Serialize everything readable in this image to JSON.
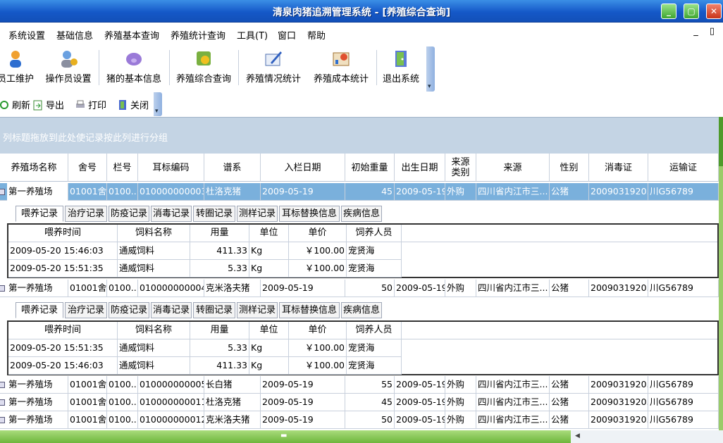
{
  "window": {
    "title": "清泉肉猪追溯管理系统 - [养殖综合查询]"
  },
  "menu": [
    "系统设置",
    "基础信息",
    "养殖基本查询",
    "养殖统计查询",
    "工具(T)",
    "窗口",
    "帮助"
  ],
  "mdi_controls": "_ ▯",
  "toolbar": [
    "员工维护",
    "操作员设置",
    "猪的基本信息",
    "养殖综合查询",
    "养殖情况统计",
    "养殖成本统计",
    "退出系统"
  ],
  "toolbar2": [
    "刷新",
    "导出",
    "打印",
    "关闭"
  ],
  "group_hint": "列标题拖放到此处使记录按此列进行分组",
  "columns": [
    "养殖场名称",
    "舍号",
    "栏号",
    "耳标编码",
    "谱系",
    "入栏日期",
    "初始重量",
    "出生日期",
    "来源\n类别",
    "来源",
    "性别",
    "消毒证",
    "运输证"
  ],
  "rows": [
    [
      "第一养殖场",
      "01001舍",
      "0100...",
      "010000000003",
      "杜洛克猪",
      "2009-05-19",
      "45",
      "2009-05-19",
      "外购",
      "四川省内江市三...",
      "公猪",
      "2009031920...",
      "川G56789"
    ],
    [
      "第一养殖场",
      "01001舍",
      "0100...",
      "010000000004",
      "克米洛夫猪",
      "2009-05-19",
      "50",
      "2009-05-19",
      "外购",
      "四川省内江市三...",
      "公猪",
      "2009031920...",
      "川G56789"
    ],
    [
      "第一养殖场",
      "01001舍",
      "0100...",
      "010000000005",
      "长白猪",
      "2009-05-19",
      "55",
      "2009-05-19",
      "外购",
      "四川省内江市三...",
      "公猪",
      "2009031920...",
      "川G56789"
    ],
    [
      "第一养殖场",
      "01001舍",
      "0100...",
      "010000000011",
      "杜洛克猪",
      "2009-05-19",
      "45",
      "2009-05-19",
      "外购",
      "四川省内江市三...",
      "公猪",
      "2009031920...",
      "川G56789"
    ],
    [
      "第一养殖场",
      "01001舍",
      "0100...",
      "010000000012",
      "克米洛夫猪",
      "2009-05-19",
      "50",
      "2009-05-19",
      "外购",
      "四川省内江市三...",
      "公猪",
      "2009031920...",
      "川G56789"
    ]
  ],
  "detail_tabs": [
    "喂养记录",
    "治疗记录",
    "防疫记录",
    "消毒记录",
    "转圈记录",
    "测样记录",
    "耳标替换信息",
    "疾病信息"
  ],
  "detail_columns": [
    "喂养时间",
    "饲料名称",
    "用量",
    "单位",
    "单价",
    "饲养人员"
  ],
  "detail1": [
    [
      "2009-05-20 15:46:03",
      "通威饲料",
      "411.33",
      "Kg",
      "￥100.00",
      "宠贤海"
    ],
    [
      "2009-05-20 15:51:35",
      "通威饲料",
      "5.33",
      "Kg",
      "￥100.00",
      "宠贤海"
    ]
  ],
  "detail2": [
    [
      "2009-05-20 15:51:35",
      "通威饲料",
      "5.33",
      "Kg",
      "￥100.00",
      "宠贤海"
    ],
    [
      "2009-05-20 15:46:03",
      "通威饲料",
      "411.33",
      "Kg",
      "￥100.00",
      "宠贤海"
    ]
  ],
  "scroll_center_glyph": "▬",
  "scroll_arrow_glyph": "◀"
}
